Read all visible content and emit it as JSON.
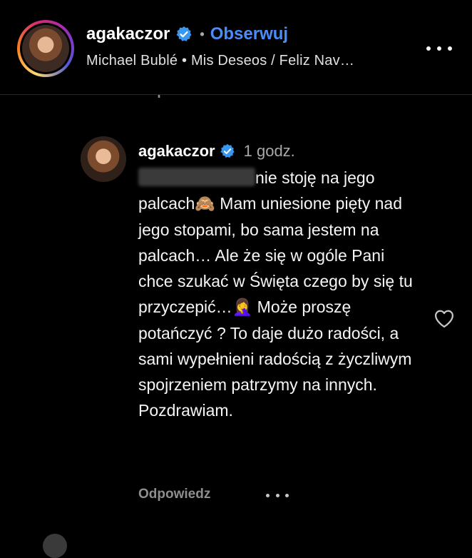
{
  "header": {
    "username": "agakaczor",
    "separator": "•",
    "follow_label": "Obserwuj",
    "track": "Michael Bublé • Mis Deseos / Feliz Nav…",
    "more_icon": "more-horizontal-icon"
  },
  "cut_reply_label": "Odpowiedz",
  "comment": {
    "username": "agakaczor",
    "time": "1 godz.",
    "text_1": "nie stoję na jego palcach",
    "emoji_1": "🙈",
    "text_2": " Mam uniesione pięty nad jego stopami, bo sama jestem na palcach… Ale że się w ogóle Pani chce szukać w Święta czego by się tu przyczepić…",
    "emoji_2": "🤦‍♀️",
    "text_3": " Może proszę potańczyć ? To daje dużo radości, a sami wypełnieni radością z życzliwym spojrzeniem patrzymy na innych. Pozdrawiam.",
    "reply_label": "Odpowiedz",
    "like_icon": "heart-outline-icon"
  },
  "colors": {
    "background": "#000000",
    "link_blue": "#4a8df8",
    "muted": "#8e8e8e",
    "verified_blue": "#3897f0"
  }
}
